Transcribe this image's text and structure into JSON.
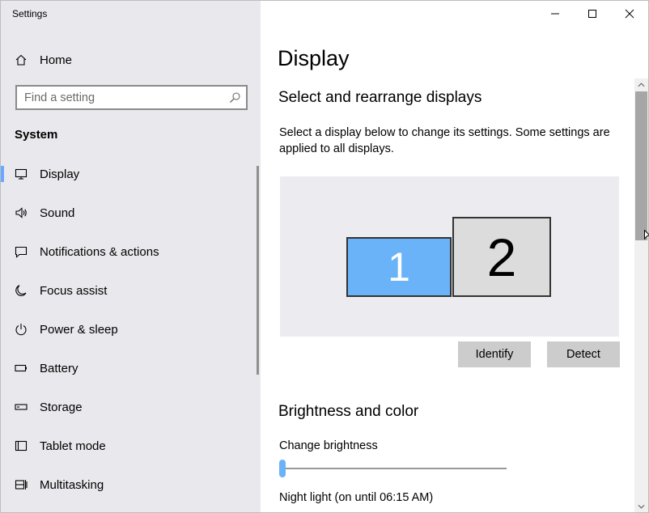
{
  "window": {
    "title": "Settings",
    "controls": [
      "minimize",
      "maximize",
      "close"
    ]
  },
  "sidebar": {
    "home_label": "Home",
    "home_icon": "home-icon",
    "search": {
      "placeholder": "Find a setting",
      "value": "",
      "icon": "search-icon"
    },
    "section_title": "System",
    "active_color": "#6aa8ff",
    "items": [
      {
        "label": "Display",
        "icon": "monitor-icon",
        "active": true
      },
      {
        "label": "Sound",
        "icon": "speaker-icon",
        "active": false
      },
      {
        "label": "Notifications & actions",
        "icon": "notification-icon",
        "active": false
      },
      {
        "label": "Focus assist",
        "icon": "moon-icon",
        "active": false
      },
      {
        "label": "Power & sleep",
        "icon": "power-icon",
        "active": false
      },
      {
        "label": "Battery",
        "icon": "battery-icon",
        "active": false
      },
      {
        "label": "Storage",
        "icon": "storage-icon",
        "active": false
      },
      {
        "label": "Tablet mode",
        "icon": "tablet-icon",
        "active": false
      },
      {
        "label": "Multitasking",
        "icon": "multitasking-icon",
        "active": false
      }
    ]
  },
  "main": {
    "title": "Display",
    "arrange": {
      "heading": "Select and rearrange displays",
      "description": "Select a display below to change its settings. Some settings are applied to all displays.",
      "displays": [
        {
          "number": "1",
          "selected": true,
          "color": "#6ab3f9"
        },
        {
          "number": "2",
          "selected": false,
          "color": "#dcdcdc"
        }
      ],
      "identify_label": "Identify",
      "detect_label": "Detect"
    },
    "brightness": {
      "heading": "Brightness and color",
      "change_label": "Change brightness",
      "brightness_value": 0,
      "night_light_label": "Night light (on until 06:15 AM)"
    }
  }
}
